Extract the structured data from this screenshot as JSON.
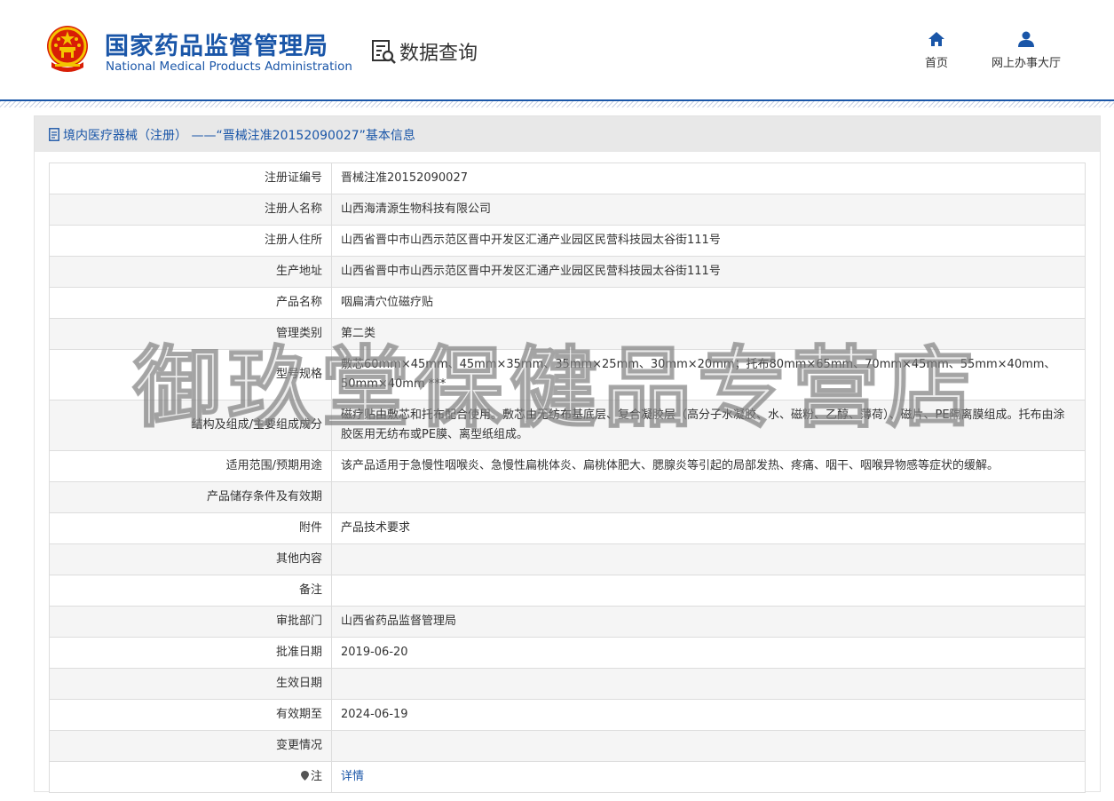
{
  "header": {
    "org_name_cn": "国家药品监督管理局",
    "org_name_en": "National Medical Products Administration",
    "query_title": "数据查询",
    "nav": [
      {
        "label": "首页",
        "icon": "home-icon"
      },
      {
        "label": "网上办事大厅",
        "icon": "user-icon"
      }
    ]
  },
  "panel": {
    "title": "境内医疗器械（注册） ——“晋械注准20152090027”基本信息"
  },
  "rows": [
    {
      "label": "注册证编号",
      "value": "晋械注准20152090027"
    },
    {
      "label": "注册人名称",
      "value": "山西海清源生物科技有限公司"
    },
    {
      "label": "注册人住所",
      "value": "山西省晋中市山西示范区晋中开发区汇通产业园区民营科技园太谷街111号"
    },
    {
      "label": "生产地址",
      "value": "山西省晋中市山西示范区晋中开发区汇通产业园区民营科技园太谷街111号"
    },
    {
      "label": "产品名称",
      "value": "咽扁清穴位磁疗贴"
    },
    {
      "label": "管理类别",
      "value": "第二类"
    },
    {
      "label": "型号规格",
      "value": "敷芯60mm×45mm、45mm×35mm、35mm×25mm、30mm×20mm；托布80mm×65mm、70mm×45mm、55mm×40mm、50mm×40mm ***"
    },
    {
      "label": "结构及组成/主要组成成分",
      "value": "磁疗贴由敷芯和托布配合使用。敷芯由无纺布基底层、复合凝胶层（高分子水凝胶、水、磁粉、乙醇、薄荷）、磁片、PE隔离膜组成。托布由涂胶医用无纺布或PE膜、离型纸组成。"
    },
    {
      "label": "适用范围/预期用途",
      "value": "该产品适用于急慢性咽喉炎、急慢性扁桃体炎、扁桃体肥大、腮腺炎等引起的局部发热、疼痛、咽干、咽喉异物感等症状的缓解。"
    },
    {
      "label": "产品储存条件及有效期",
      "value": ""
    },
    {
      "label": "附件",
      "value": "产品技术要求"
    },
    {
      "label": "其他内容",
      "value": ""
    },
    {
      "label": "备注",
      "value": ""
    },
    {
      "label": "审批部门",
      "value": "山西省药品监督管理局"
    },
    {
      "label": "批准日期",
      "value": "2019-06-20"
    },
    {
      "label": "生效日期",
      "value": ""
    },
    {
      "label": "有效期至",
      "value": "2024-06-19"
    },
    {
      "label": "变更情况",
      "value": ""
    }
  ],
  "note": {
    "label": "注",
    "link": "详情"
  },
  "watermark": "御玖堂保健品专营店",
  "colors": {
    "brand_blue": "#1a56a8",
    "title_bar": "#e8e8e8",
    "row_alt": "#f5f5f5"
  }
}
